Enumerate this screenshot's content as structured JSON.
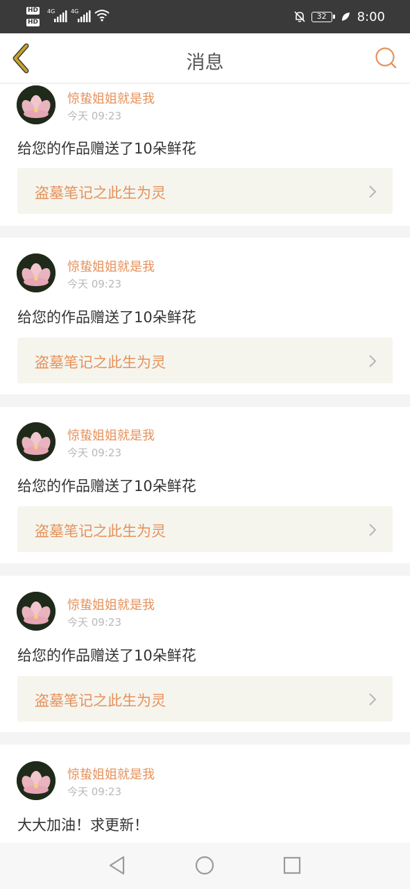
{
  "status_bar": {
    "hd1": "HD",
    "hd2": "HD",
    "net1": "4G",
    "net2": "4G",
    "battery": "32",
    "time": "8:00"
  },
  "header": {
    "title": "消息"
  },
  "messages": [
    {
      "user": "惊蛰姐姐就是我",
      "time": "今天 09:23",
      "text": "给您的作品赠送了10朵鲜花",
      "work": "盗墓笔记之此生为灵"
    },
    {
      "user": "惊蛰姐姐就是我",
      "time": "今天 09:23",
      "text": "给您的作品赠送了10朵鲜花",
      "work": "盗墓笔记之此生为灵"
    },
    {
      "user": "惊蛰姐姐就是我",
      "time": "今天 09:23",
      "text": "给您的作品赠送了10朵鲜花",
      "work": "盗墓笔记之此生为灵"
    },
    {
      "user": "惊蛰姐姐就是我",
      "time": "今天 09:23",
      "text": "给您的作品赠送了10朵鲜花",
      "work": "盗墓笔记之此生为灵"
    },
    {
      "user": "惊蛰姐姐就是我",
      "time": "今天 09:23",
      "text": "大大加油！求更新！"
    }
  ],
  "icons": {
    "back": "back-chevron-icon",
    "search": "search-icon",
    "work_arrow": "chevron-right-icon",
    "nav_back": "triangle-back-icon",
    "nav_home": "circle-home-icon",
    "nav_recent": "square-recents-icon"
  },
  "colors": {
    "accent": "#e6915b",
    "back_icon": "#c9a227",
    "link_bg": "#f5f5ee",
    "status_bar": "#3a3a3a"
  }
}
